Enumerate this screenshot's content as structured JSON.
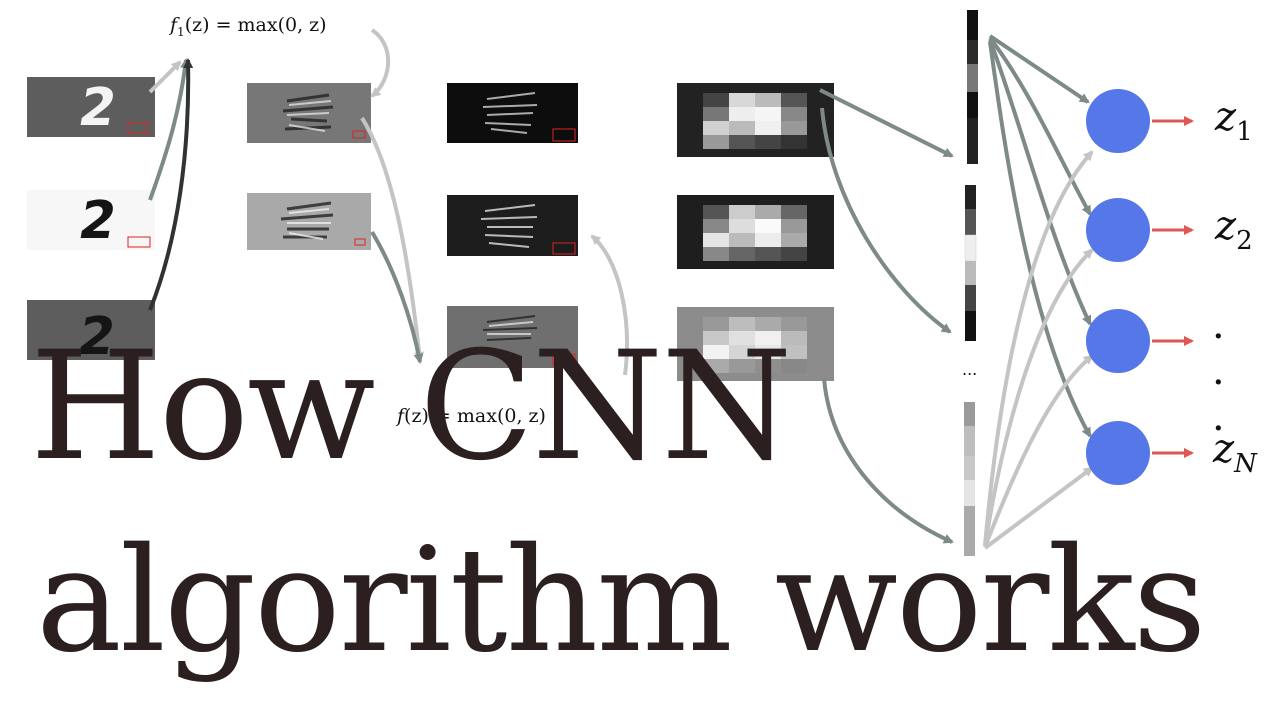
{
  "title": {
    "line1": "How CNN",
    "line2": "algorithm works"
  },
  "formulas": {
    "relu_top": {
      "fn": "f",
      "index": "1",
      "arg": "(z)",
      "rhs": " = max(0, z)"
    },
    "relu_mid": {
      "fn": "f",
      "arg": "(z)",
      "rhs": " = max(0, z)"
    }
  },
  "outputs": [
    {
      "var": "z",
      "index": "1"
    },
    {
      "var": "z",
      "index": "2"
    },
    {
      "text": "· · ·"
    },
    {
      "var": "z",
      "index": "N"
    }
  ],
  "vector_ellipsis": "...",
  "input_digit": "2",
  "colors": {
    "neuron": "#5577e8",
    "output_arrow": "#e05555",
    "arrow_dark": "#7d8a88",
    "arrow_light": "#c4c4c4",
    "arrow_black": "#2f3433",
    "title": "#2b1f1f"
  }
}
